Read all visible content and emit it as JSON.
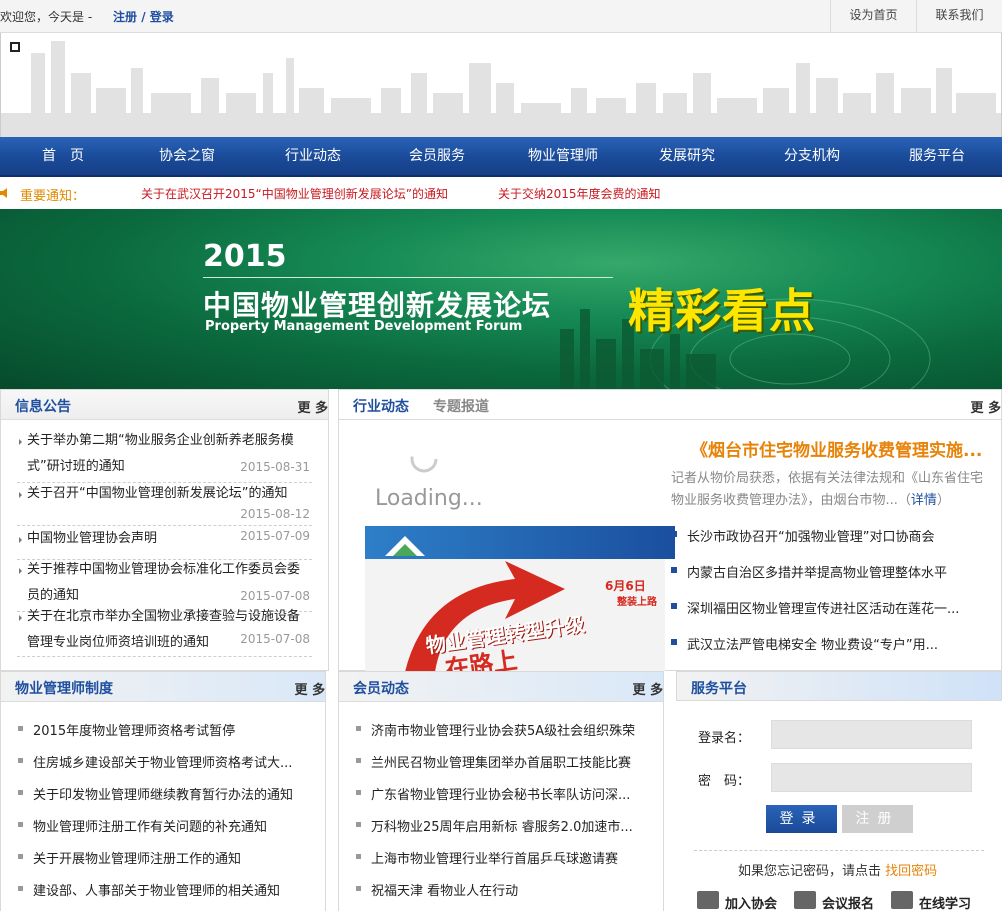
{
  "topbar": {
    "welcome": "欢迎您，今天是 -",
    "login": "注册",
    "sep": " / ",
    "register": "登录",
    "set_home": "设为首页",
    "contact": "联系我们"
  },
  "nav": [
    "首　页",
    "协会之窗",
    "行业动态",
    "会员服务",
    "物业管理师",
    "发展研究",
    "分支机构",
    "服务平台"
  ],
  "notice": {
    "label": "重要通知：",
    "items": [
      "关于在武汉召开2015“中国物业管理创新发展论坛”的通知",
      "关于交纳2015年度会费的通知"
    ]
  },
  "banner": {
    "year": "2015",
    "title": "中国物业管理创新发展论坛",
    "subtitle_en": "Property Management Development Forum",
    "highlight": "精彩看点"
  },
  "info_panel": {
    "title": "信息公告",
    "more": "更 多",
    "items": [
      {
        "text": "关于举办第二期“物业服务企业创新养老服务模式”研讨班的通知",
        "date": "2015-08-31"
      },
      {
        "text": "关于召开“中国物业管理创新发展论坛”的通知",
        "date": "2015-08-12"
      },
      {
        "text": "中国物业管理协会声明",
        "date": "2015-07-09"
      },
      {
        "text": "关于推荐中国物业管理协会标准化工作委员会委员的通知",
        "date": "2015-07-08"
      },
      {
        "text": "关于在北京市举办全国物业承接查验与设施设备管理专业岗位师资培训班的通知",
        "date": "2015-07-08"
      }
    ]
  },
  "news_panel": {
    "tab1": "行业动态",
    "tab2": "专题报道",
    "more": "更 多",
    "loading": "Loading...",
    "slide_date": "6月6日",
    "slide_sub": "整装上路",
    "slide_text": "物业管理转型升级",
    "slide_text2": "在路上",
    "headline": "《烟台市住宅物业服务收费管理实施...",
    "summary": "记者从物价局获悉，依据有关法律法规和《山东省住宅物业服务收费管理办法》，由烟台市物...",
    "detail": "详情",
    "items": [
      "长沙市政协召开“加强物业管理”对口协商会",
      "内蒙古自治区多措并举提高物业管理整体水平",
      "深圳福田区物业管理宣传进社区活动在莲花一...",
      "武汉立法严管电梯安全 物业费设“专户”用..."
    ]
  },
  "manager_panel": {
    "title": "物业管理师制度",
    "more": "更 多",
    "items": [
      "2015年度物业管理师资格考试暂停",
      "住房城乡建设部关于物业管理师资格考试大...",
      "关于印发物业管理师继续教育暂行办法的通知",
      "物业管理师注册工作有关问题的补充通知",
      "关于开展物业管理师注册工作的通知",
      "建设部、人事部关于物业管理师的相关通知"
    ]
  },
  "member_panel": {
    "title": "会员动态",
    "more": "更 多",
    "items": [
      "济南市物业管理行业协会获5A级社会组织殊荣",
      "兰州民召物业管理集团举办首届职工技能比赛",
      "广东省物业管理行业协会秘书长率队访问深...",
      "万科物业25周年启用新标 睿服务2.0加速市...",
      "上海市物业管理行业举行首届乒乓球邀请赛",
      "祝福天津 看物业人在行动"
    ]
  },
  "service_panel": {
    "title": "服务平台",
    "user_label": "登录名：",
    "pwd_label": "密　码：",
    "login_btn": "登录",
    "register_btn": "注册",
    "forgot_text": "如果您忘记密码，请点击",
    "forgot_link": "找回密码",
    "quick": [
      "加入协会",
      "会议报名",
      "在线学习"
    ]
  },
  "colors": {
    "nav_blue": "#1f4f9e",
    "notice_red": "#c8171e",
    "notice_orange": "#e08a00",
    "headline_orange": "#e8830a"
  }
}
